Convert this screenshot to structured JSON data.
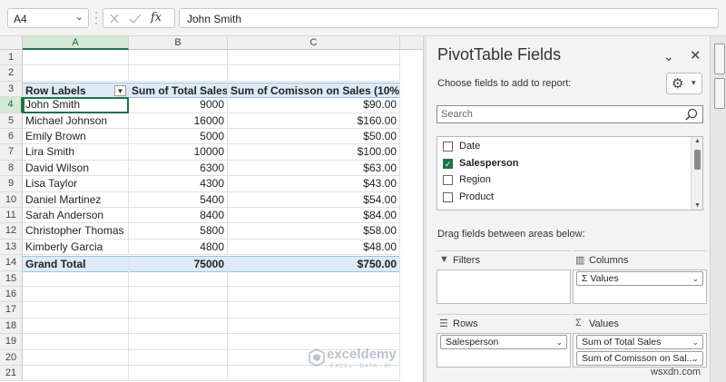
{
  "formula_bar": {
    "name_box": "A4",
    "formula": "John Smith",
    "fx_label": "fx"
  },
  "columns": [
    "A",
    "B",
    "C"
  ],
  "row_numbers": [
    "1",
    "2",
    "3",
    "4",
    "5",
    "6",
    "7",
    "8",
    "9",
    "10",
    "11",
    "12",
    "13",
    "14",
    "15",
    "16",
    "17",
    "18",
    "19",
    "20",
    "21"
  ],
  "pivot_table": {
    "headers": [
      "Row Labels",
      "Sum of Total Sales",
      "Sum of Comisson on Sales (10%)"
    ],
    "rows": [
      [
        "John Smith",
        "9000",
        "$90.00"
      ],
      [
        "Michael Johnson",
        "16000",
        "$160.00"
      ],
      [
        "Emily Brown",
        "5000",
        "$50.00"
      ],
      [
        "Lira Smith",
        "10000",
        "$100.00"
      ],
      [
        "David Wilson",
        "6300",
        "$63.00"
      ],
      [
        "Lisa Taylor",
        "4300",
        "$43.00"
      ],
      [
        "Daniel Martinez",
        "5400",
        "$54.00"
      ],
      [
        "Sarah Anderson",
        "8400",
        "$84.00"
      ],
      [
        "Christopher Thomas",
        "5800",
        "$58.00"
      ],
      [
        "Kimberly Garcia",
        "4800",
        "$48.00"
      ]
    ],
    "grand_total": [
      "Grand Total",
      "75000",
      "$750.00"
    ]
  },
  "watermark": {
    "name": "exceldemy",
    "tagline": "EXCEL · DATA · BI"
  },
  "pivot_pane": {
    "title": "PivotTable Fields",
    "subtitle": "Choose fields to add to report:",
    "search_placeholder": "Search",
    "fields": [
      {
        "label": "Date",
        "checked": false
      },
      {
        "label": "Salesperson",
        "checked": true
      },
      {
        "label": "Region",
        "checked": false
      },
      {
        "label": "Product",
        "checked": false
      }
    ],
    "drag_hint": "Drag fields between areas below:",
    "areas": {
      "filters": {
        "title": "Filters",
        "items": []
      },
      "columns": {
        "title": "Columns",
        "items": [
          "Σ Values"
        ]
      },
      "rows": {
        "title": "Rows",
        "items": [
          "Salesperson"
        ]
      },
      "values": {
        "title": "Values",
        "items": [
          "Sum of Total Sales",
          "Sum of Comisson on Sal..."
        ]
      }
    }
  },
  "site_credit": "wsxdn.com"
}
